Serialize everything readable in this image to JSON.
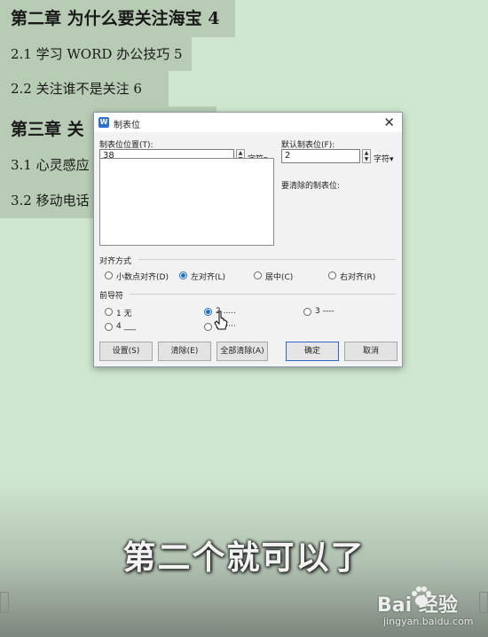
{
  "document": {
    "lines": [
      {
        "text": "第二章  为什么要关注海宝 4"
      },
      {
        "text": "2.1  学习 WORD 办公技巧 5"
      },
      {
        "text": "2.2  关注谁不是关注 6"
      },
      {
        "text": "第三章  关"
      },
      {
        "text": "3.1  心灵感应"
      },
      {
        "text": "3.2  移动电话"
      }
    ]
  },
  "dialog": {
    "title": "制表位",
    "tab_position_label": "制表位位置(T):",
    "tab_position_value": "38",
    "tab_unit": "字符▾",
    "default_tab_label": "默认制表位(F):",
    "default_tab_value": "2",
    "default_unit": "字符▾",
    "clear_label": "要清除的制表位:",
    "alignment": {
      "label": "对齐方式",
      "options": [
        "小数点对齐(D)",
        "左对齐(L)",
        "居中(C)",
        "右对齐(R)"
      ],
      "selected": "左对齐(L)"
    },
    "leader": {
      "label": "前导符",
      "options": [
        "1 无",
        "2 .....",
        "3 ----",
        "4 ___",
        "5 ·····"
      ],
      "selected": "2 ....."
    },
    "buttons": {
      "set": "设置(S)",
      "clear": "清除(E)",
      "clear_all": "全部清除(A)",
      "ok": "确定",
      "cancel": "取消"
    }
  },
  "subtitle": "第二个就可以了",
  "watermark": {
    "logo": "Bai  经验",
    "url": "jingyan.baidu.com"
  }
}
